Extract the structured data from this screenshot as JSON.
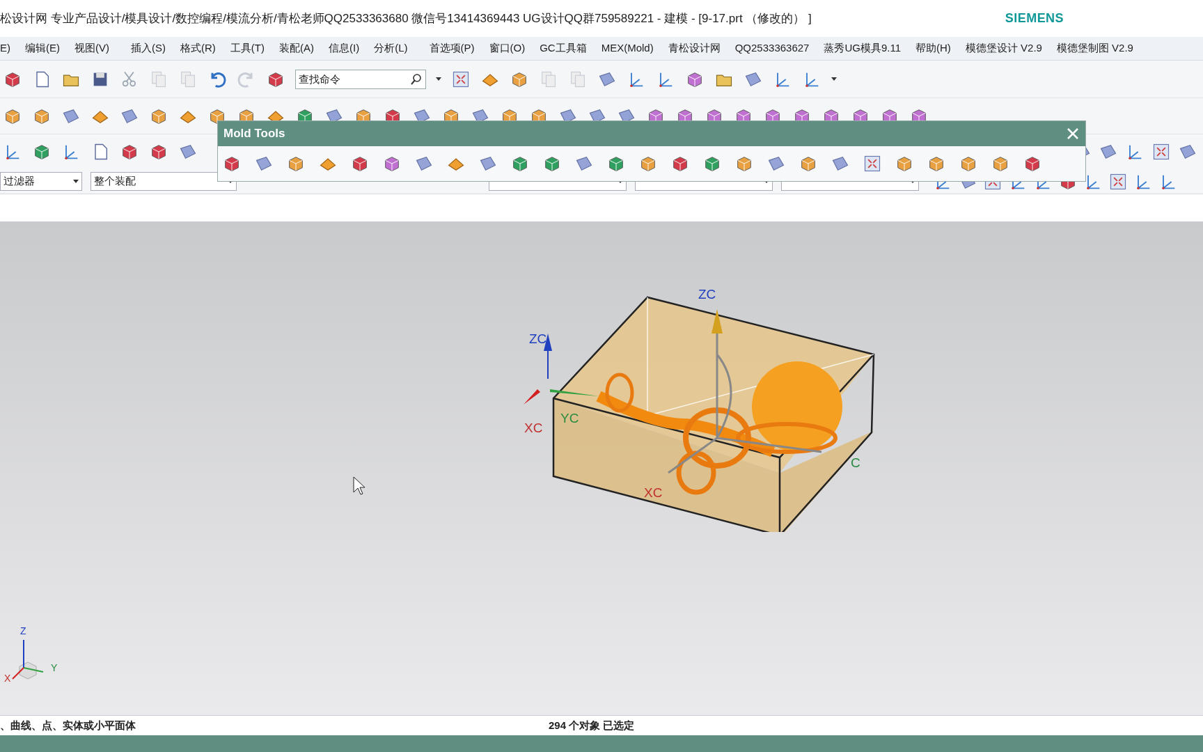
{
  "window": {
    "title": "松设计网 专业产品设计/模具设计/数控编程/模流分析/青松老师QQ2533363680 微信号13414369443 UG设计QQ群759589221 - 建模 - [9-17.prt （修改的） ]",
    "brand": "SIEMENS"
  },
  "menu": [
    "E)",
    "编辑(E)",
    "视图(V)",
    "插入(S)",
    "格式(R)",
    "工具(T)",
    "装配(A)",
    "信息(I)",
    "分析(L)",
    "首选项(P)",
    "窗口(O)",
    "GC工具箱",
    "MEX(Mold)",
    "青松设计网",
    "QQ2533363627",
    "蒸秀UG模具9.11",
    "帮助(H)",
    "模德堡设计 V2.9",
    "模德堡制图 V2.9"
  ],
  "search": {
    "placeholder": "查找命令"
  },
  "filters": [
    {
      "value": "过滤器"
    },
    {
      "value": "整个装配"
    }
  ],
  "mold_tools": {
    "title": "Mold Tools"
  },
  "viewport": {
    "labels": [
      {
        "text": "ZC",
        "kind": "z"
      },
      {
        "text": "XC",
        "kind": "x"
      },
      {
        "text": "YC",
        "kind": "y"
      },
      {
        "text": "ZC",
        "kind": "z"
      },
      {
        "text": "XC",
        "kind": "x"
      },
      {
        "text": "C",
        "kind": "y"
      }
    ],
    "triad": [
      {
        "text": "Z",
        "kind": "z"
      },
      {
        "text": "Y",
        "kind": "y"
      },
      {
        "text": "X",
        "kind": "x"
      }
    ]
  },
  "status_bar": {
    "prompt": "、曲线、点、实体或小平面体",
    "selection": "294 个对象 已选定"
  }
}
